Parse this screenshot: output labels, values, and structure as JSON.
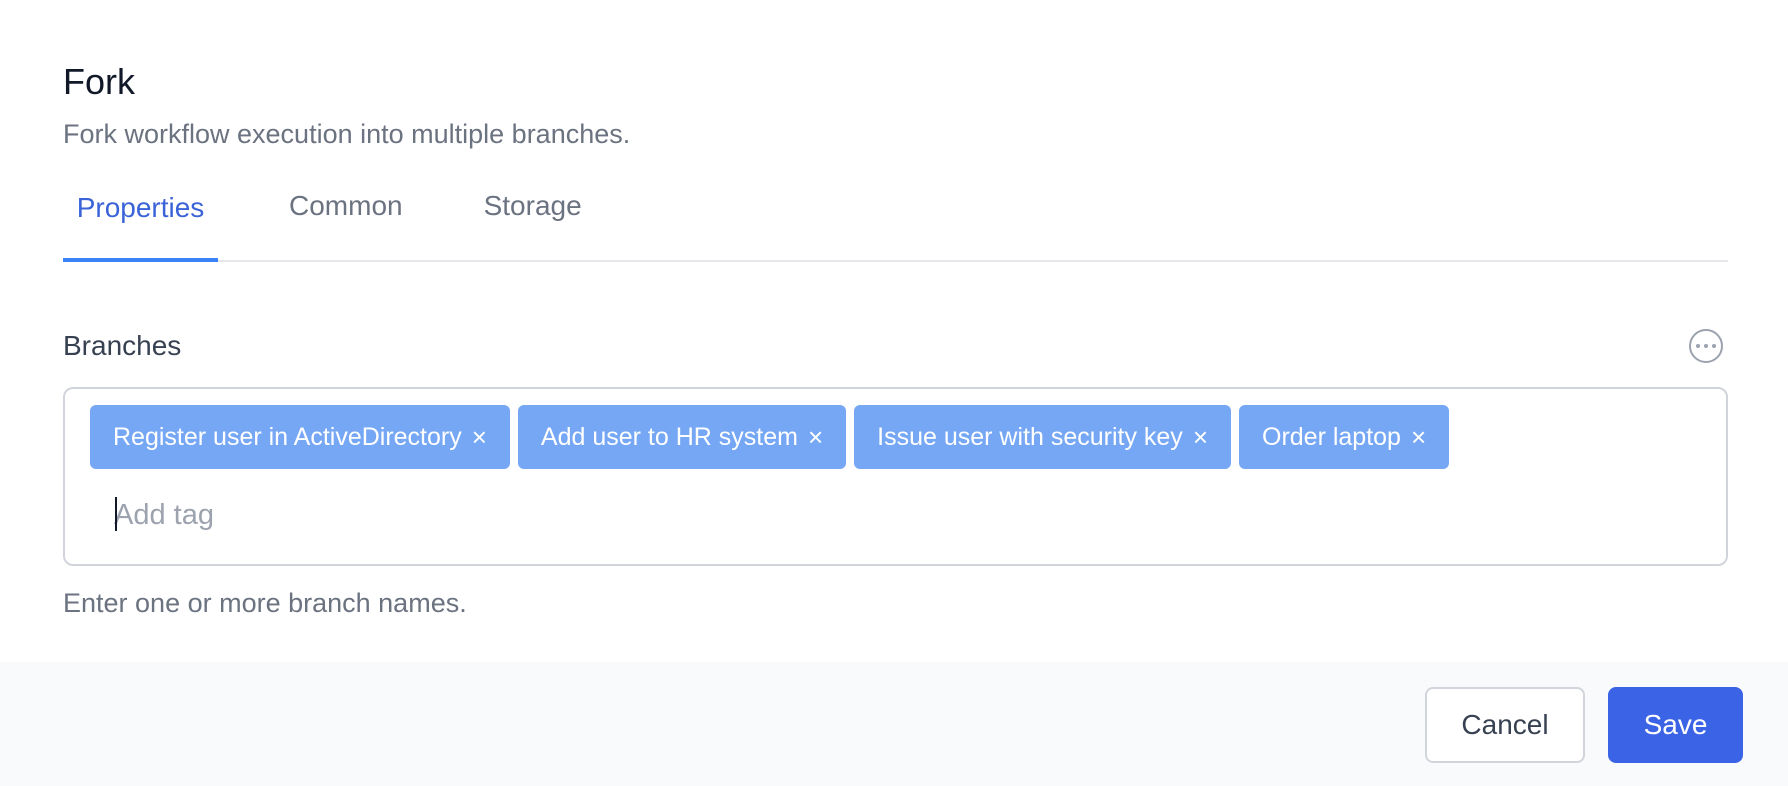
{
  "dialog": {
    "title": "Fork",
    "description": "Fork workflow execution into multiple branches."
  },
  "tabs": [
    {
      "label": "Properties",
      "active": true
    },
    {
      "label": "Common",
      "active": false
    },
    {
      "label": "Storage",
      "active": false
    }
  ],
  "branches": {
    "label": "Branches",
    "tags": [
      "Register user in ActiveDirectory",
      "Add user to HR system",
      "Issue user with security key",
      "Order laptop"
    ],
    "remove_symbol": "×",
    "input_placeholder": "Add tag",
    "input_value": "",
    "hint": "Enter one or more branch names.",
    "menu_icon": "more-horizontal-circle-icon"
  },
  "footer": {
    "cancel_label": "Cancel",
    "save_label": "Save"
  },
  "colors": {
    "accent": "#3b63e6",
    "tab_active": "#3b63d8",
    "tag_bg": "#76a7f4",
    "footer_bg": "#f9fafb"
  }
}
